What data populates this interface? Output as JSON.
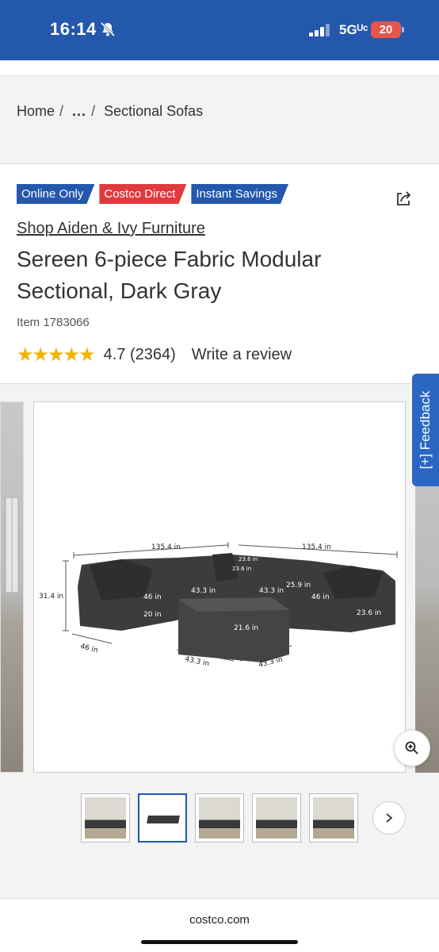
{
  "status_bar": {
    "time": "16:14",
    "network": "5Gᵁᶜ",
    "battery": "20"
  },
  "breadcrumb": {
    "home": "Home",
    "ellipsis": "...",
    "current": "Sectional Sofas"
  },
  "badges": [
    {
      "label": "Online Only",
      "color": "#2358ad"
    },
    {
      "label": "Costco Direct",
      "color": "#e13a3e"
    },
    {
      "label": "Instant Savings",
      "color": "#2358ad"
    }
  ],
  "product": {
    "brand": "Shop Aiden & Ivy Furniture",
    "title": "Sereen 6-piece Fabric Modular Sectional, Dark Gray",
    "item_number": "Item 1783066",
    "stars": "★★★★★",
    "rating_text": "4.7 (2364)",
    "review_link": "Write a review"
  },
  "diagram": {
    "dims": {
      "w1": "135.4 in",
      "w2": "135.4 in",
      "h": "31.4 in",
      "d": "46 in",
      "d2": "46 in",
      "d3": "46 in",
      "s1": "43.3 in",
      "s2": "43.3 in",
      "a": "20 in",
      "b": "23.6 in",
      "c": "23.6 in",
      "e": "21.6 in",
      "f": "25.9 in",
      "g": "23.6 in",
      "o1": "43.3 in",
      "o2": "43.3 in"
    }
  },
  "feedback": {
    "label": "[+] Feedback"
  },
  "bottom": {
    "url": "costco.com"
  },
  "colors": {
    "brand_blue": "#2358ad",
    "brand_red": "#e13a3e",
    "star": "#f0b400"
  }
}
